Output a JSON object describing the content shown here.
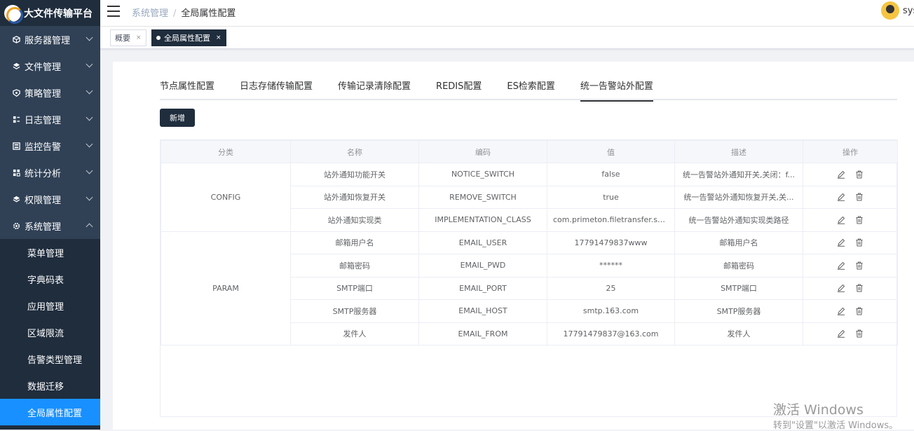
{
  "brand": {
    "title": "大文件传输平台"
  },
  "sidebar": {
    "items": [
      {
        "label": "服务器管理",
        "icon": "cube-icon",
        "expanded": false
      },
      {
        "label": "文件管理",
        "icon": "layers-icon",
        "expanded": false
      },
      {
        "label": "策略管理",
        "icon": "shield-icon",
        "expanded": false
      },
      {
        "label": "日志管理",
        "icon": "grid-icon",
        "expanded": false
      },
      {
        "label": "监控告警",
        "icon": "monitor-icon",
        "expanded": false
      },
      {
        "label": "统计分析",
        "icon": "chart-icon",
        "expanded": false
      },
      {
        "label": "权限管理",
        "icon": "lock-icon",
        "expanded": false
      },
      {
        "label": "系统管理",
        "icon": "gear-icon",
        "expanded": true
      }
    ],
    "sub_items": [
      {
        "label": "菜单管理",
        "active": false
      },
      {
        "label": "字典码表",
        "active": false
      },
      {
        "label": "应用管理",
        "active": false
      },
      {
        "label": "区域限流",
        "active": false
      },
      {
        "label": "告警类型管理",
        "active": false
      },
      {
        "label": "数据迁移",
        "active": false
      },
      {
        "label": "全局属性配置",
        "active": true
      }
    ]
  },
  "header": {
    "breadcrumb": [
      "系统管理",
      "全局属性配置"
    ],
    "separator": "/",
    "username": "sys"
  },
  "tagsbar": {
    "tags": [
      {
        "label": "概要",
        "active": false
      },
      {
        "label": "全局属性配置",
        "active": true
      }
    ],
    "close_glyph": "×"
  },
  "tabs": [
    "节点属性配置",
    "日志存储传输配置",
    "传输记录清除配置",
    "REDIS配置",
    "ES检索配置",
    "统一告警站外配置"
  ],
  "add_button": "新增",
  "table": {
    "headers": [
      "分类",
      "名称",
      "编码",
      "值",
      "描述",
      "操作"
    ],
    "groups": [
      {
        "category": "CONFIG",
        "rows": [
          {
            "name": "站外通知功能开关",
            "code": "NOTICE_SWITCH",
            "value": "false",
            "desc": "统一告警站外通知开关,关闭：f..."
          },
          {
            "name": "站外通知恢复开关",
            "code": "REMOVE_SWITCH",
            "value": "true",
            "desc": "统一告警站外通知恢复开关,关..."
          },
          {
            "name": "站外通知实现类",
            "code": "IMPLEMENTATION_CLASS",
            "value": "com.primeton.filetransfer.server...",
            "desc": "统一告警站外通知实现类路径"
          }
        ]
      },
      {
        "category": "PARAM",
        "rows": [
          {
            "name": "邮箱用户名",
            "code": "EMAIL_USER",
            "value": "17791479837www",
            "desc": "邮箱用户名"
          },
          {
            "name": "邮箱密码",
            "code": "EMAIL_PWD",
            "value": "******",
            "desc": "邮箱密码"
          },
          {
            "name": "SMTP端口",
            "code": "EMAIL_PORT",
            "value": "25",
            "desc": "SMTP端口"
          },
          {
            "name": "SMTP服务器",
            "code": "EMAIL_HOST",
            "value": "smtp.163.com",
            "desc": "SMTP服务器"
          },
          {
            "name": "发件人",
            "code": "EMAIL_FROM",
            "value": "17791479837@163.com",
            "desc": "发件人"
          }
        ]
      }
    ]
  },
  "watermark": {
    "line1": "激活 Windows",
    "line2": "转到\"设置\"以激活 Windows。"
  }
}
